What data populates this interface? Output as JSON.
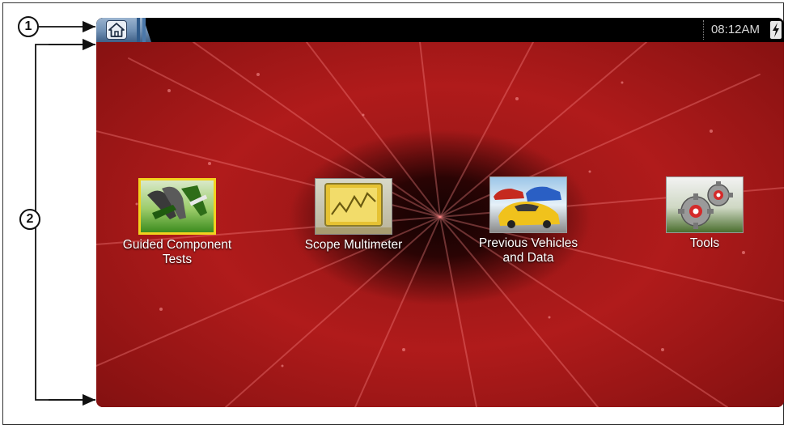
{
  "callouts": [
    "1",
    "2"
  ],
  "statusbar": {
    "home_icon": "home-icon",
    "clock": "08:12AM",
    "battery_icon": "battery-charging-icon"
  },
  "apps": [
    {
      "label_line1": "Guided Component",
      "label_line2": "Tests",
      "icon": "component-test-icon"
    },
    {
      "label_line1": "Scope Multimeter",
      "label_line2": "",
      "icon": "scope-multimeter-icon"
    },
    {
      "label_line1": "Previous Vehicles",
      "label_line2": "and Data",
      "icon": "previous-vehicles-icon"
    },
    {
      "label_line1": "Tools",
      "label_line2": "",
      "icon": "tools-gear-icon"
    }
  ],
  "colors": {
    "background_red": "#b01b1b",
    "selection_border": "#f2d21e",
    "titlebar": "#000000"
  }
}
